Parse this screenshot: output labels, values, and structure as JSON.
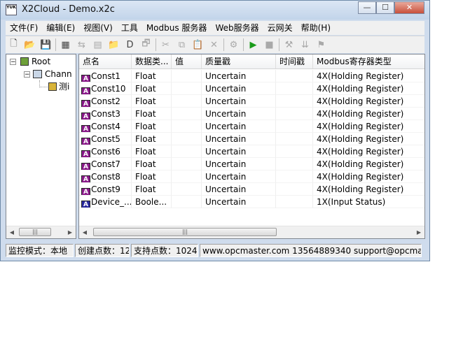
{
  "window": {
    "title": "X2Cloud - Demo.x2c",
    "app_icon_text": "YUK",
    "minimize": "—",
    "maximize": "☐",
    "close": "✕"
  },
  "menu": [
    {
      "label": "文件(F)"
    },
    {
      "label": "编辑(E)"
    },
    {
      "label": "视图(V)"
    },
    {
      "label": "工具"
    },
    {
      "label": "Modbus 服务器"
    },
    {
      "label": "Web服务器"
    },
    {
      "label": "云网关"
    },
    {
      "label": "帮助(H)"
    }
  ],
  "toolbar": [
    {
      "icon": "new-file-icon",
      "glyph": "🗋",
      "enabled": true
    },
    {
      "icon": "open-folder-icon",
      "glyph": "📂",
      "enabled": true
    },
    {
      "icon": "save-icon",
      "glyph": "💾",
      "enabled": false
    },
    {
      "sep": true
    },
    {
      "icon": "new-channel-icon",
      "glyph": "▦",
      "enabled": true
    },
    {
      "icon": "channel-arrow-icon",
      "glyph": "⇆",
      "enabled": false
    },
    {
      "icon": "device-icon",
      "glyph": "▤",
      "enabled": false
    },
    {
      "icon": "new-group-icon",
      "glyph": "📁",
      "enabled": true
    },
    {
      "icon": "new-tag-icon",
      "glyph": "D",
      "enabled": true
    },
    {
      "icon": "properties-icon",
      "glyph": "🗗",
      "enabled": false
    },
    {
      "sep": true
    },
    {
      "icon": "cut-icon",
      "glyph": "✂",
      "enabled": false
    },
    {
      "icon": "copy-icon",
      "glyph": "⧉",
      "enabled": false
    },
    {
      "icon": "paste-icon",
      "glyph": "📋",
      "enabled": false
    },
    {
      "icon": "delete-icon",
      "glyph": "✕",
      "enabled": false
    },
    {
      "sep": true
    },
    {
      "icon": "monitor-icon",
      "glyph": "⚙",
      "enabled": false
    },
    {
      "sep": true
    },
    {
      "icon": "run-icon",
      "glyph": "▶",
      "enabled": true
    },
    {
      "icon": "stop-icon",
      "glyph": "■",
      "enabled": false
    },
    {
      "sep": true
    },
    {
      "icon": "tools-icon",
      "glyph": "⚒",
      "enabled": false
    },
    {
      "icon": "load-icon",
      "glyph": "⇊",
      "enabled": false
    },
    {
      "icon": "config-icon",
      "glyph": "⚑",
      "enabled": false
    }
  ],
  "tree": {
    "root": "Root",
    "channel": "Chann",
    "device": "测i"
  },
  "columns": [
    "点名",
    "数据类...",
    "值",
    "质量戳",
    "时间戳",
    "Modbus寄存器类型"
  ],
  "rows": [
    {
      "name": "Const1",
      "type": "Float",
      "value": "",
      "quality": "Uncertain",
      "time": "",
      "modbus": "4X(Holding Register)"
    },
    {
      "name": "Const10",
      "type": "Float",
      "value": "",
      "quality": "Uncertain",
      "time": "",
      "modbus": "4X(Holding Register)"
    },
    {
      "name": "Const2",
      "type": "Float",
      "value": "",
      "quality": "Uncertain",
      "time": "",
      "modbus": "4X(Holding Register)"
    },
    {
      "name": "Const3",
      "type": "Float",
      "value": "",
      "quality": "Uncertain",
      "time": "",
      "modbus": "4X(Holding Register)"
    },
    {
      "name": "Const4",
      "type": "Float",
      "value": "",
      "quality": "Uncertain",
      "time": "",
      "modbus": "4X(Holding Register)"
    },
    {
      "name": "Const5",
      "type": "Float",
      "value": "",
      "quality": "Uncertain",
      "time": "",
      "modbus": "4X(Holding Register)"
    },
    {
      "name": "Const6",
      "type": "Float",
      "value": "",
      "quality": "Uncertain",
      "time": "",
      "modbus": "4X(Holding Register)"
    },
    {
      "name": "Const7",
      "type": "Float",
      "value": "",
      "quality": "Uncertain",
      "time": "",
      "modbus": "4X(Holding Register)"
    },
    {
      "name": "Const8",
      "type": "Float",
      "value": "",
      "quality": "Uncertain",
      "time": "",
      "modbus": "4X(Holding Register)"
    },
    {
      "name": "Const9",
      "type": "Float",
      "value": "",
      "quality": "Uncertain",
      "time": "",
      "modbus": "4X(Holding Register)"
    },
    {
      "name": "Device_...",
      "type": "Boole...",
      "value": "",
      "quality": "Uncertain",
      "time": "",
      "modbus": "1X(Input Status)"
    }
  ],
  "status": {
    "mode": "监控模式：本地",
    "created": "创建点数：12",
    "supported": "支持点数：1024",
    "contact": "www.opcmaster.com 13564889340 support@opcma"
  },
  "colors": {
    "float_tag": "#8b1a8b",
    "bool_tag": "#2a2aa0"
  }
}
